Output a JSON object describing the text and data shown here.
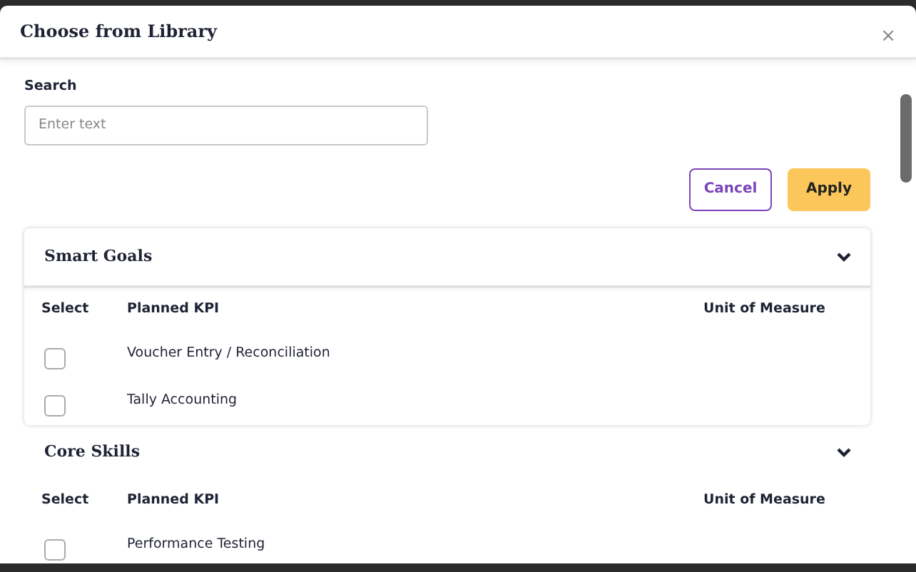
{
  "dialog": {
    "title": "Choose from Library",
    "close": "×"
  },
  "search": {
    "label": "Search",
    "placeholder": "Enter text"
  },
  "buttons": [
    {
      "kind": "secondary",
      "label": "Cancel"
    },
    {
      "kind": "primary",
      "label": "Apply"
    }
  ],
  "sections": [
    {
      "title": "Smart Goals",
      "expanded": true,
      "columns": [
        "Select",
        "Planned KPI",
        "Unit of Measure"
      ],
      "rows": [
        {
          "kpi": "Voucher Entry / Reconciliation",
          "checked": false
        },
        {
          "kpi": "Tally Accounting",
          "checked": false
        }
      ]
    },
    {
      "title": "Core Skills",
      "expanded": true,
      "columns": [
        "Select",
        "Planned KPI",
        "Unit of Measure"
      ],
      "rows": [
        {
          "kpi": "Performance Testing",
          "checked": false
        }
      ]
    }
  ]
}
